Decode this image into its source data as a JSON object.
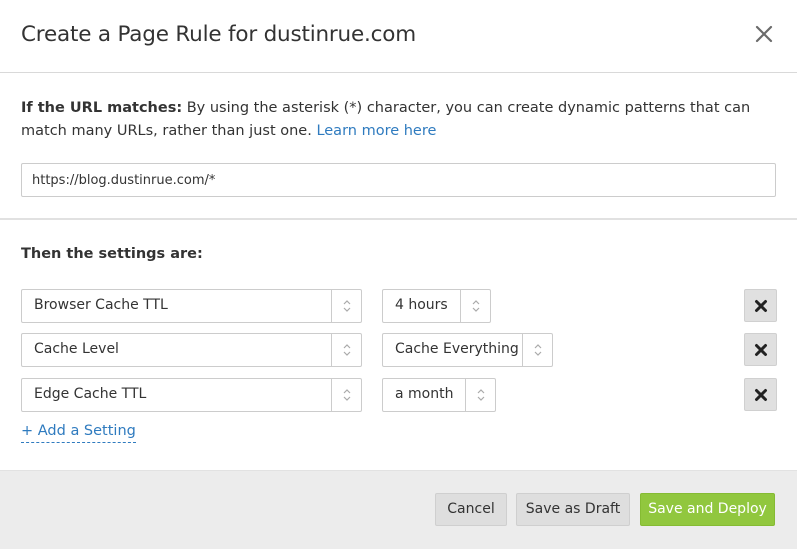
{
  "dialog": {
    "title": "Create a Page Rule for dustinrue.com",
    "close_icon": "close-icon"
  },
  "url_section": {
    "label": "If the URL matches:",
    "description": " By using the asterisk (*) character, you can create dynamic patterns that can match many URLs, rather than just one. ",
    "learn_more": "Learn more here",
    "url_value": "https://blog.dustinrue.com/*"
  },
  "settings": {
    "heading": "Then the settings are:",
    "rows": [
      {
        "setting": "Browser Cache TTL",
        "value": "4 hours"
      },
      {
        "setting": "Cache Level",
        "value": "Cache Everything"
      },
      {
        "setting": "Edge Cache TTL",
        "value": "a month"
      }
    ],
    "add_label": "+ Add a Setting"
  },
  "footer": {
    "cancel": "Cancel",
    "save_draft": "Save as Draft",
    "save_deploy": "Save and Deploy"
  },
  "colors": {
    "link": "#2f7bbf",
    "deploy_button": "#91c73e",
    "footer_bg": "#ececec"
  }
}
